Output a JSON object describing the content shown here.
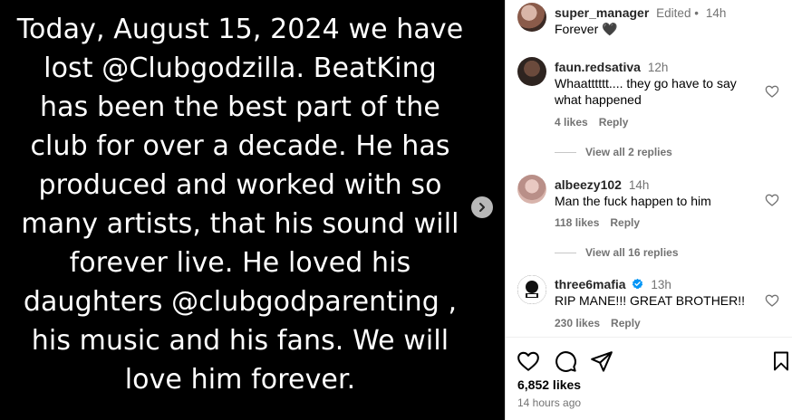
{
  "post": {
    "lines": [
      "Today, August 15, 2024 we have",
      "lost @Clubgodzilla. BeatKing",
      "has been the best part of the",
      "club for over a decade. He has",
      "produced and worked with so",
      "many artists, that his sound will",
      "forever live. He loved his",
      "daughters @clubgodparenting ,",
      "his music and his fans. We will",
      "love him forever."
    ]
  },
  "caption": {
    "username": "super_manager",
    "edited": "Edited •",
    "time": "14h",
    "text": "Forever 🖤"
  },
  "comments": [
    {
      "username": "faun.redsativa",
      "time": "12h",
      "text": "Whaatttttt.... they go have to say what happened",
      "likes": "4 likes",
      "reply": "Reply",
      "view_replies": "View all 2 replies"
    },
    {
      "username": "albeezy102",
      "time": "14h",
      "text": "Man the fuck happen to him",
      "likes": "118 likes",
      "reply": "Reply",
      "view_replies": "View all 16 replies"
    },
    {
      "username": "three6mafia",
      "time": "13h",
      "text": "RIP MANE!!! GREAT BROTHER!!",
      "likes": "230 likes",
      "reply": "Reply",
      "verified": true
    }
  ],
  "footer": {
    "likes": "6,852 likes",
    "time_ago": "14 hours ago"
  },
  "colors": {
    "media_bg": "#000000",
    "verified_blue": "#0095f6",
    "muted_text": "#737373"
  }
}
